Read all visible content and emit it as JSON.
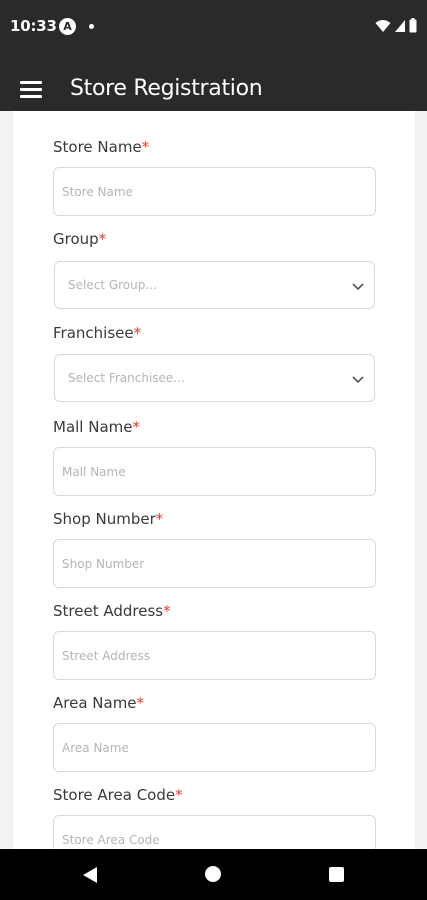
{
  "status_bar": {
    "time": "10:33",
    "app_icon_glyph": "A"
  },
  "app_bar": {
    "title": "Store Registration"
  },
  "form": {
    "required_marker": "*",
    "store_name": {
      "label": "Store Name",
      "placeholder": "Store Name"
    },
    "group": {
      "label": "Group",
      "placeholder": "Select Group..."
    },
    "franchisee": {
      "label": "Franchisee",
      "placeholder": "Select Franchisee..."
    },
    "mall_name": {
      "label": "Mall Name",
      "placeholder": "Mall Name"
    },
    "shop_number": {
      "label": "Shop Number",
      "placeholder": "Shop Number"
    },
    "street_address": {
      "label": "Street Address",
      "placeholder": "Street Address"
    },
    "area_name": {
      "label": "Area Name",
      "placeholder": "Area Name"
    },
    "store_area_code": {
      "label": "Store Area Code",
      "placeholder": "Store Area Code"
    }
  },
  "colors": {
    "bar": "#2b292b",
    "required": "#e53935",
    "nav": "#000000"
  },
  "icons": [
    "menu-icon",
    "wifi-icon",
    "signal-icon",
    "battery-icon",
    "chevron-down-icon",
    "back-icon",
    "home-icon",
    "recents-icon"
  ]
}
